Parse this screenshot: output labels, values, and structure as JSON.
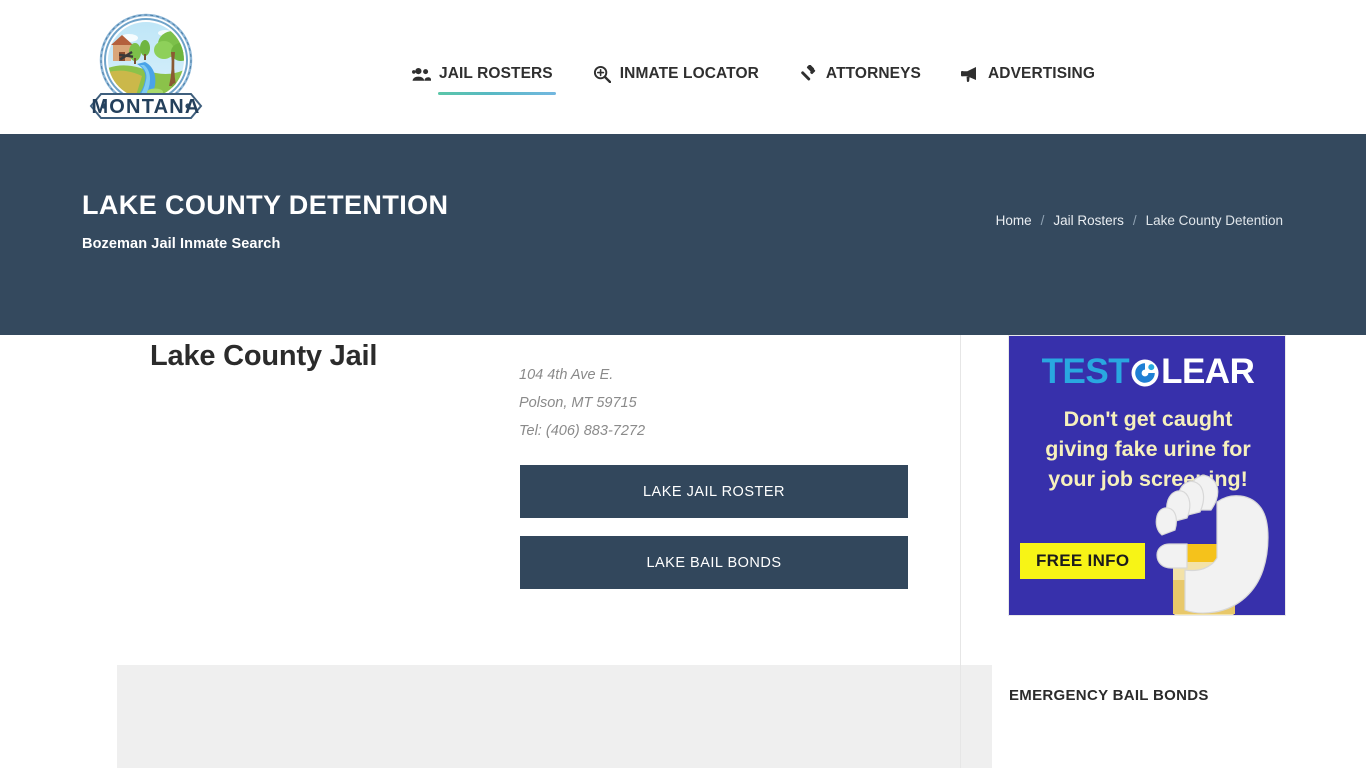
{
  "header": {
    "logo": {
      "icon": "montana-badge-logo",
      "ribbon_text": "MONTANA"
    },
    "nav": [
      {
        "label": "JAIL ROSTERS",
        "icon": "users-icon",
        "active": true
      },
      {
        "label": "INMATE LOCATOR",
        "icon": "search-plus-icon",
        "active": false
      },
      {
        "label": "ATTORNEYS",
        "icon": "gavel-icon",
        "active": false
      },
      {
        "label": "ADVERTISING",
        "icon": "bullhorn-icon",
        "active": false
      }
    ]
  },
  "banner": {
    "title": "LAKE COUNTY DETENTION",
    "subtitle": "Bozeman Jail Inmate Search",
    "background_color": "#34495e",
    "breadcrumb": [
      {
        "label": "Home",
        "current": false
      },
      {
        "label": "Jail Rosters",
        "current": false
      },
      {
        "label": "Lake County Detention",
        "current": true
      }
    ],
    "breadcrumb_separator": "/"
  },
  "main": {
    "jail_name": "Lake County Jail",
    "address": {
      "street": "104 4th Ave E.",
      "city_state_zip": "Polson, MT 59715",
      "phone": "Tel: (406) 883-7272"
    },
    "buttons": [
      {
        "label": "LAKE JAIL ROSTER",
        "color": "#32475c"
      },
      {
        "label": "LAKE BAIL BONDS",
        "color": "#32475c"
      }
    ]
  },
  "sidebar": {
    "ad": {
      "brand_part1": "TEST",
      "brand_mark": "c-circle-icon",
      "brand_part2": "LEAR",
      "headline_line1": "Don't get caught",
      "headline_line2": "giving fake urine for",
      "headline_line3": "your job screening!",
      "cta_label": "FREE INFO",
      "background_color": "#3730ab",
      "cta_color": "#f7f416",
      "headline_color": "#f6f0bd"
    },
    "section_heading": "EMERGENCY BAIL BONDS"
  }
}
